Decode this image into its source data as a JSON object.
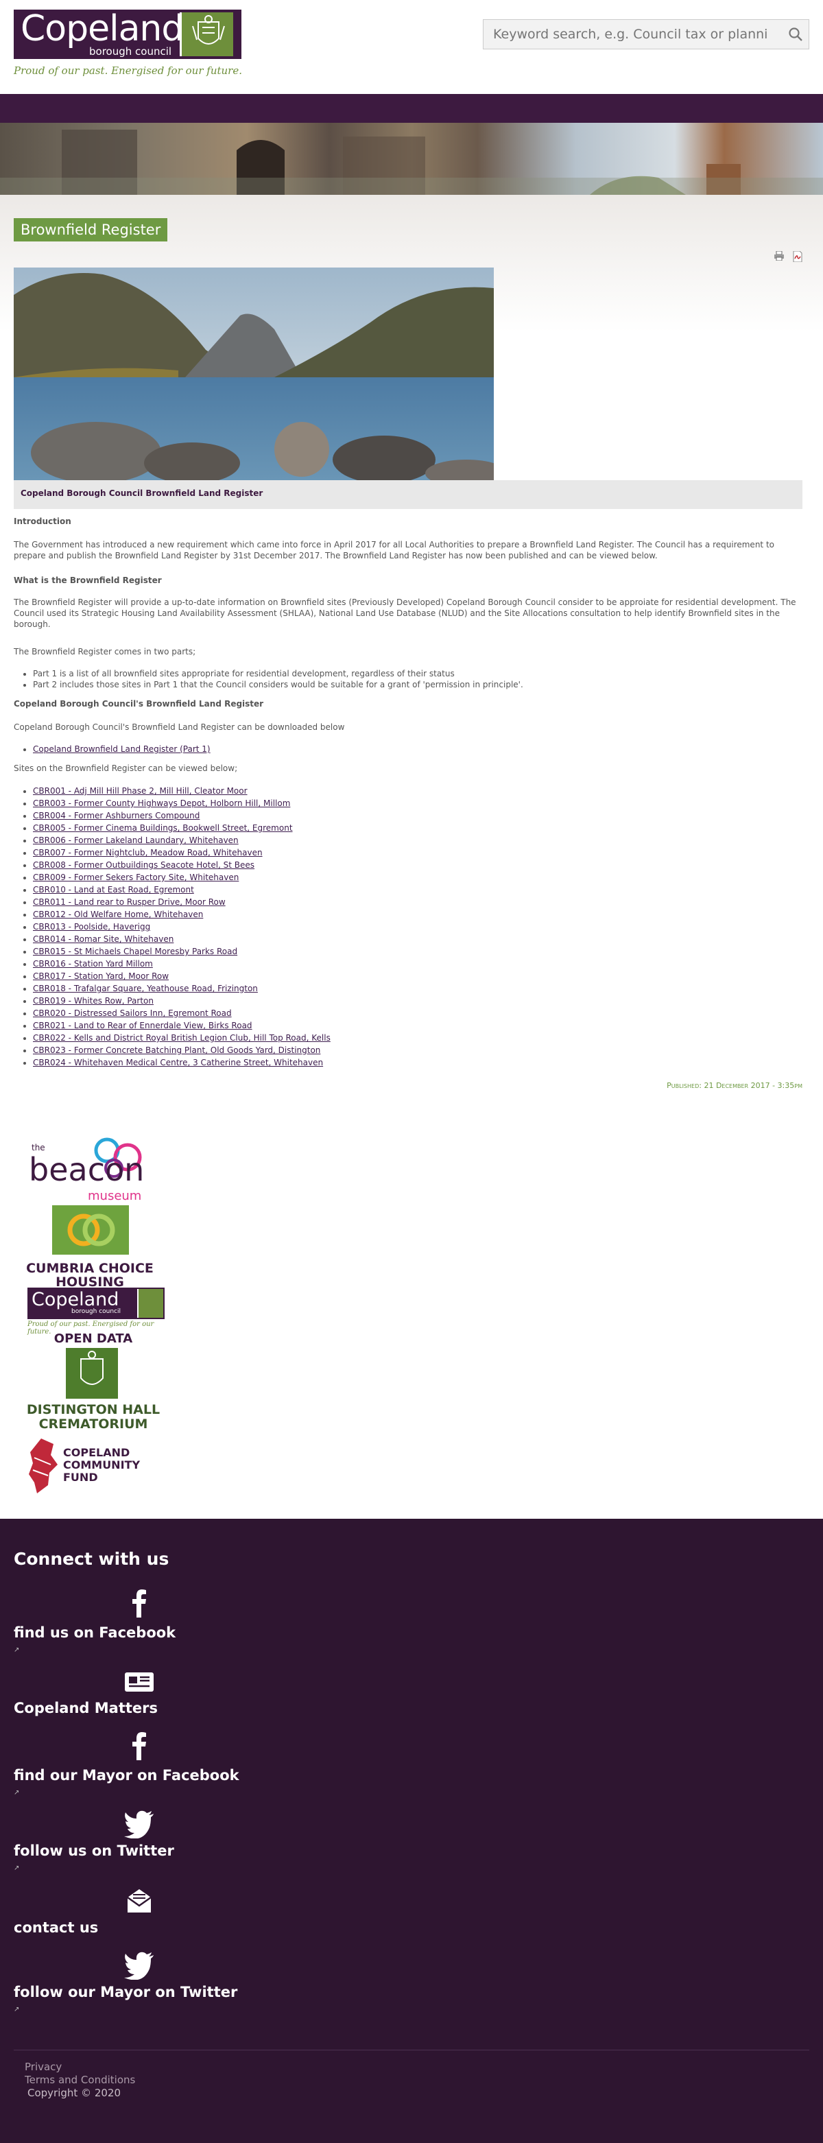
{
  "header": {
    "logo_name": "Copeland",
    "logo_sub": "borough council",
    "tagline": "Proud of our past. Energised for our future.",
    "search_placeholder": "Keyword search, e.g. Council tax or planning"
  },
  "main": {
    "page_title": "Brownfield Register",
    "caption": "Copeland Borough Council Brownfield Land Register",
    "intro_heading": "Introduction",
    "intro_text": "The Government has introduced a new requirement which came into force in April 2017 for all Local Authorities to prepare a Brownfield Land Register.  The Council has a requirement to prepare and publish the Brownfield Land Register by 31st December 2017.  The Brownfield Land Register has now been published and can be viewed below.",
    "what_heading": "What is the Brownfield Register",
    "what_text": "The Brownfield Register will provide a up-to-date information on Brownfield sites (Previously Developed) Copeland Borough Council consider to be approiate for residential development.  The Council used its Strategic Housing Land Availability Assessment (SHLAA), National Land Use Database (NLUD) and the Site Allocations consultation to help identify Brownfield sites in the borough.",
    "two_parts_text": "The Brownfield Register comes in two parts;",
    "parts": [
      "Part 1 is a list of all brownfield sites appropriate for residential development, regardless of their status",
      "Part 2 includes those sites in Part 1 that the Council considers would be suitable for a grant of 'permission in principle'."
    ],
    "register_heading": "Copeland Borough Council's Brownfield Land Register",
    "download_text": "Copeland Borough Council's Brownfield Land Register can be downloaded below",
    "download_link": "Copeland Brownfield Land Register (Part 1)",
    "sites_text": "Sites on the Brownfield Register can be viewed below;",
    "sites": [
      "CBR001 - Adj Mill Hill Phase 2, Mill Hill, Cleator Moor",
      "CBR003 - Former County Highways Depot, Holborn Hill, Millom",
      "CBR004 - Former Ashburners Compound",
      "CBR005 - Former Cinema Buildings, Bookwell Street, Egremont",
      "CBR006 - Former Lakeland Laundary, Whitehaven",
      "CBR007 - Former Nightclub, Meadow Road, Whitehaven",
      "CBR008 - Former Outbuildings Seacote Hotel, St Bees",
      "CBR009 - Former Sekers Factory Site, Whitehaven",
      "CBR010 - Land at East Road, Egremont",
      "CBR011 - Land rear to Rusper Drive, Moor Row",
      "CBR012 - Old Welfare Home, Whitehaven",
      "CBR013 - Poolside, Haverigg",
      "CBR014 - Romar Site, Whitehaven",
      "CBR015 - St Michaels Chapel Moresby Parks Road",
      "CBR016 - Station Yard Millom",
      "CBR017 - Station Yard, Moor Row",
      "CBR018 - Trafalgar Square, Yeathouse Road, Frizington",
      "CBR019 - Whites Row, Parton",
      "CBR020 - Distressed Sailors Inn, Egremont Road",
      "CBR021 - Land to Rear of Ennerdale View, Birks Road",
      "CBR022 - Kells and District Royal British Legion Club, Hill Top Road, Kells",
      "CBR023 - Former Concrete Batching Plant, Old Goods Yard, Distington",
      "CBR024 - Whitehaven Medical Centre, 3 Catherine Street, Whitehaven"
    ],
    "published": "Published: 21 December 2017 - 3:35pm"
  },
  "partners": {
    "beacon_small": "the",
    "beacon_name": "beacon",
    "beacon_sub": "museum",
    "ccp_text": "CUMBRIA CHOICE HOUSING",
    "od_name": "Copeland",
    "od_sub": "borough council",
    "od_tag": "Proud of our past. Energised for our future.",
    "od_text": "OPEN DATA",
    "dh_text": "DISTINGTON HALL CREMATORIUM",
    "cf_text": "COPELAND COMMUNITY FUND"
  },
  "footer": {
    "heading": "Connect with us",
    "links": [
      {
        "label": "find us on Facebook",
        "icon": "facebook-icon"
      },
      {
        "label": "Copeland Matters",
        "icon": "newspaper-icon"
      },
      {
        "label": "find our Mayor on Facebook",
        "icon": "facebook-icon"
      },
      {
        "label": "follow us on Twitter",
        "icon": "twitter-icon"
      },
      {
        "label": "contact us",
        "icon": "envelope-icon"
      },
      {
        "label": "follow our Mayor on Twitter",
        "icon": "twitter-icon"
      }
    ],
    "privacy": "Privacy",
    "terms": "Terms and Conditions",
    "copyright": "Copyright © 2020"
  },
  "colors": {
    "brand_purple": "#3d1a40",
    "brand_green": "#6e9a43",
    "footer_bg": "#2e1530"
  }
}
